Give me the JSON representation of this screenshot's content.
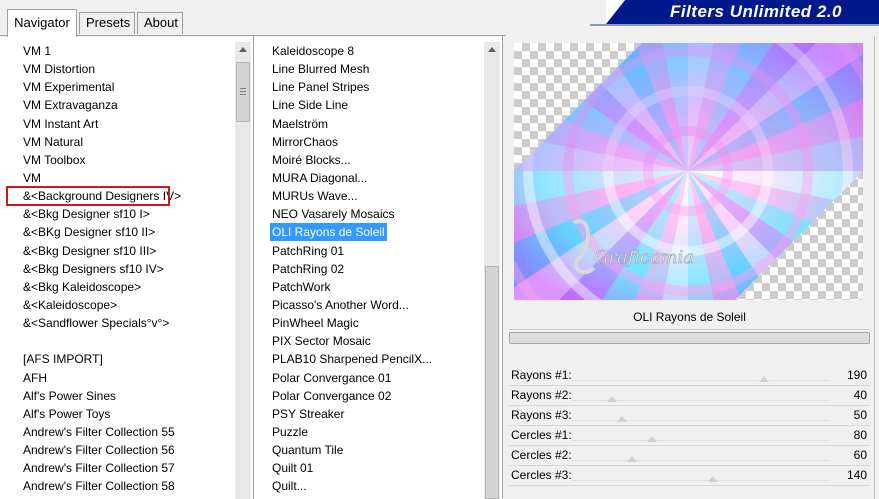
{
  "tabs": [
    {
      "label": "Navigator",
      "active": true
    },
    {
      "label": "Presets",
      "active": false
    },
    {
      "label": "About",
      "active": false
    }
  ],
  "banner": {
    "title": "Filters Unlimited 2.0",
    "color": "#001a8c"
  },
  "categories": {
    "items": [
      "VM 1",
      "VM Distortion",
      "VM Experimental",
      "VM Extravaganza",
      "VM Instant Art",
      "VM Natural",
      "VM Toolbox",
      "VM",
      "&<Background Designers IV>",
      "&<Bkg Designer sf10 I>",
      "&<BKg Designer sf10 II>",
      "&<Bkg Designer sf10 III>",
      "&<Bkg Designers sf10 IV>",
      "&<Bkg Kaleidoscope>",
      "&<Kaleidoscope>",
      "&<Sandflower Specials°v°>",
      "",
      "[AFS IMPORT]",
      "AFH",
      "Alf's Power Sines",
      "Alf's Power Toys",
      "Andrew's Filter Collection 55",
      "Andrew's Filter Collection 56",
      "Andrew's Filter Collection 57",
      "Andrew's Filter Collection 58"
    ],
    "highlighted": "&<BKg Designer sf10 II>",
    "highlight_color": "#d11818",
    "scroll_position": 0.06
  },
  "filters": {
    "items": [
      "Kaleidoscope 8",
      "Line Blurred Mesh",
      "Line Panel Stripes",
      "Line Side Line",
      "Maelström",
      "MirrorChaos",
      "Moiré Blocks...",
      "MURA Diagonal...",
      "MURUs Wave...",
      "NEO Vasarely Mosaics",
      "OLI Rayons de Soleil",
      "PatchRing 01",
      "PatchRing 02",
      "PatchWork",
      "Picasso's Another Word...",
      "PinWheel Magic",
      "PIX Sector Mosaic",
      "PLAB10 Sharpened PencilX...",
      "Polar Convergance 01",
      "Polar Convergance 02",
      "PSY Streaker",
      "Puzzle",
      "Quantum Tile",
      "Quilt 01",
      "Quilt..."
    ],
    "selected": "OLI Rayons de Soleil",
    "selected_color": "#3399ff",
    "scroll_position": 0.95
  },
  "selected_filter_label": "OLI Rayons de Soleil",
  "watermark_text": "Graficamia",
  "parameters": [
    {
      "label": "Rayons #1:",
      "value": 190
    },
    {
      "label": "Rayons #2:",
      "value": 40
    },
    {
      "label": "Rayons #3:",
      "value": 50
    },
    {
      "label": "Cercles #1:",
      "value": 80
    },
    {
      "label": "Cercles #2:",
      "value": 60
    },
    {
      "label": "Cercles #3:",
      "value": 140
    }
  ],
  "parameter_max": 255
}
